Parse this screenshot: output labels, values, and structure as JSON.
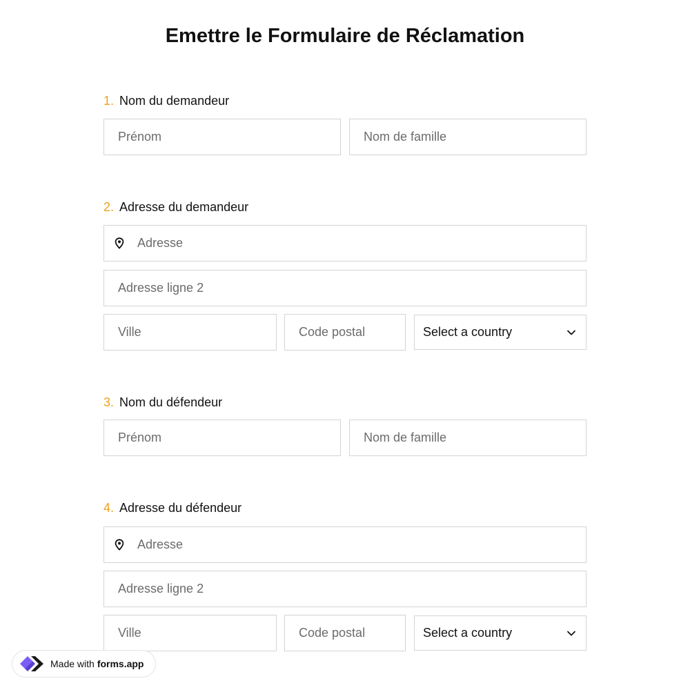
{
  "page": {
    "title": "Emettre le Formulaire de Réclamation"
  },
  "questions": [
    {
      "number": "1.",
      "label": "Nom du demandeur",
      "first_name_placeholder": "Prénom",
      "last_name_placeholder": "Nom de famille"
    },
    {
      "number": "2.",
      "label": "Adresse du demandeur",
      "address_placeholder": "Adresse",
      "address2_placeholder": "Adresse ligne 2",
      "city_placeholder": "Ville",
      "zip_placeholder": "Code postal",
      "country_select": "Select a country"
    },
    {
      "number": "3.",
      "label": "Nom du défendeur",
      "first_name_placeholder": "Prénom",
      "last_name_placeholder": "Nom de famille"
    },
    {
      "number": "4.",
      "label": "Adresse du défendeur",
      "address_placeholder": "Adresse",
      "address2_placeholder": "Adresse ligne 2",
      "city_placeholder": "Ville",
      "zip_placeholder": "Code postal",
      "country_select": "Select a country"
    }
  ],
  "badge": {
    "prefix": "Made with",
    "brand": "forms.app"
  },
  "icons": {
    "address": "map-pin-icon",
    "select": "chevron-down-icon",
    "brand": "forms-app-logo-icon"
  },
  "colors": {
    "question_number": "#f0a21b",
    "field_border": "#d4d4d4",
    "placeholder_text": "#6b6b6b",
    "logo_primary": "#7b5cf5"
  }
}
